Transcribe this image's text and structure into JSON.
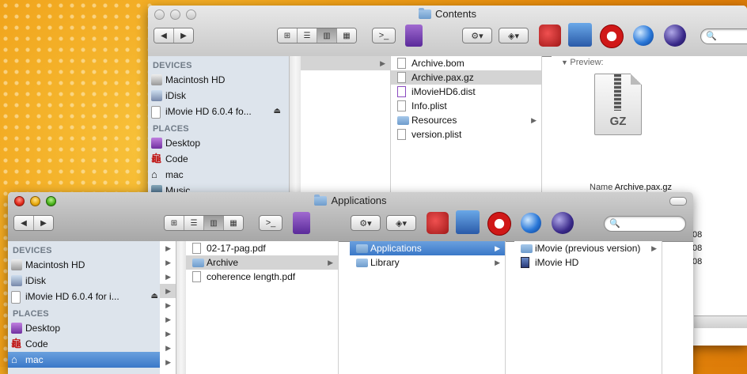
{
  "back_window": {
    "title": "Contents",
    "sidebar": {
      "devices_header": "DEVICES",
      "devices": [
        {
          "label": "Macintosh HD",
          "icon": "hard-drive-icon"
        },
        {
          "label": "iDisk",
          "icon": "idisk-icon"
        },
        {
          "label": "iMovie HD 6.0.4 fo...",
          "icon": "disk-image-icon",
          "eject": "⏏"
        }
      ],
      "places_header": "PLACES",
      "places": [
        {
          "label": "Desktop",
          "icon": "desktop-icon"
        },
        {
          "label": "Code",
          "icon": "code-icon"
        },
        {
          "label": "mac",
          "icon": "home-icon"
        },
        {
          "label": "Music",
          "icon": "music-icon"
        }
      ]
    },
    "column2_items": [
      {
        "label": "Archive.bom",
        "kind": "file"
      },
      {
        "label": "Archive.pax.gz",
        "kind": "file",
        "selected": true
      },
      {
        "label": "iMovieHD6.dist",
        "kind": "file"
      },
      {
        "label": "Info.plist",
        "kind": "file"
      },
      {
        "label": "Resources",
        "kind": "folder",
        "arrow": "▶"
      },
      {
        "label": "version.plist",
        "kind": "file"
      }
    ],
    "column1_arrow": "▶",
    "preview": {
      "label": "Preview:",
      "icon_label": "GZ",
      "name_key": "Name",
      "name_value": "Archive.pax.gz",
      "clipped_right_digits": [
        "08",
        "08",
        "08"
      ]
    }
  },
  "front_window": {
    "title": "Applications",
    "sidebar": {
      "devices_header": "DEVICES",
      "devices": [
        {
          "label": "Macintosh HD",
          "icon": "hard-drive-icon"
        },
        {
          "label": "iDisk",
          "icon": "idisk-icon"
        },
        {
          "label": "iMovie HD 6.0.4 for i...",
          "icon": "disk-image-icon",
          "eject": "⏏"
        }
      ],
      "places_header": "PLACES",
      "places": [
        {
          "label": "Desktop",
          "icon": "desktop-icon"
        },
        {
          "label": "Code",
          "icon": "code-icon"
        },
        {
          "label": "mac",
          "icon": "home-icon",
          "selected": true
        }
      ]
    },
    "column1_items": [
      {
        "label": "02-17-pag.pdf",
        "kind": "file"
      },
      {
        "label": "Archive",
        "kind": "folder",
        "selected": true,
        "arrow": "▶"
      },
      {
        "label": "coherence length.pdf",
        "kind": "file"
      }
    ],
    "column2_items": [
      {
        "label": "Applications",
        "kind": "folder",
        "selected": true,
        "arrow": "▶"
      },
      {
        "label": "Library",
        "kind": "folder",
        "arrow": "▶"
      }
    ],
    "column3_items": [
      {
        "label": "iMovie (previous version)",
        "kind": "folder",
        "arrow": "▶"
      },
      {
        "label": "iMovie HD",
        "kind": "app"
      }
    ],
    "column0_arrows": [
      "▶",
      "▶",
      "▶",
      "▶",
      "▶",
      "▶",
      "▶",
      "▶",
      "▶"
    ]
  },
  "toolbar": {
    "back": "◀",
    "forward": "▶",
    "view_icon": "⊞",
    "view_list": "☰",
    "view_column": "▥",
    "view_coverflow": "▦",
    "terminal": ">_",
    "action": "⚙▾",
    "dropbox": "◈▾",
    "search_icon": "🔍"
  }
}
